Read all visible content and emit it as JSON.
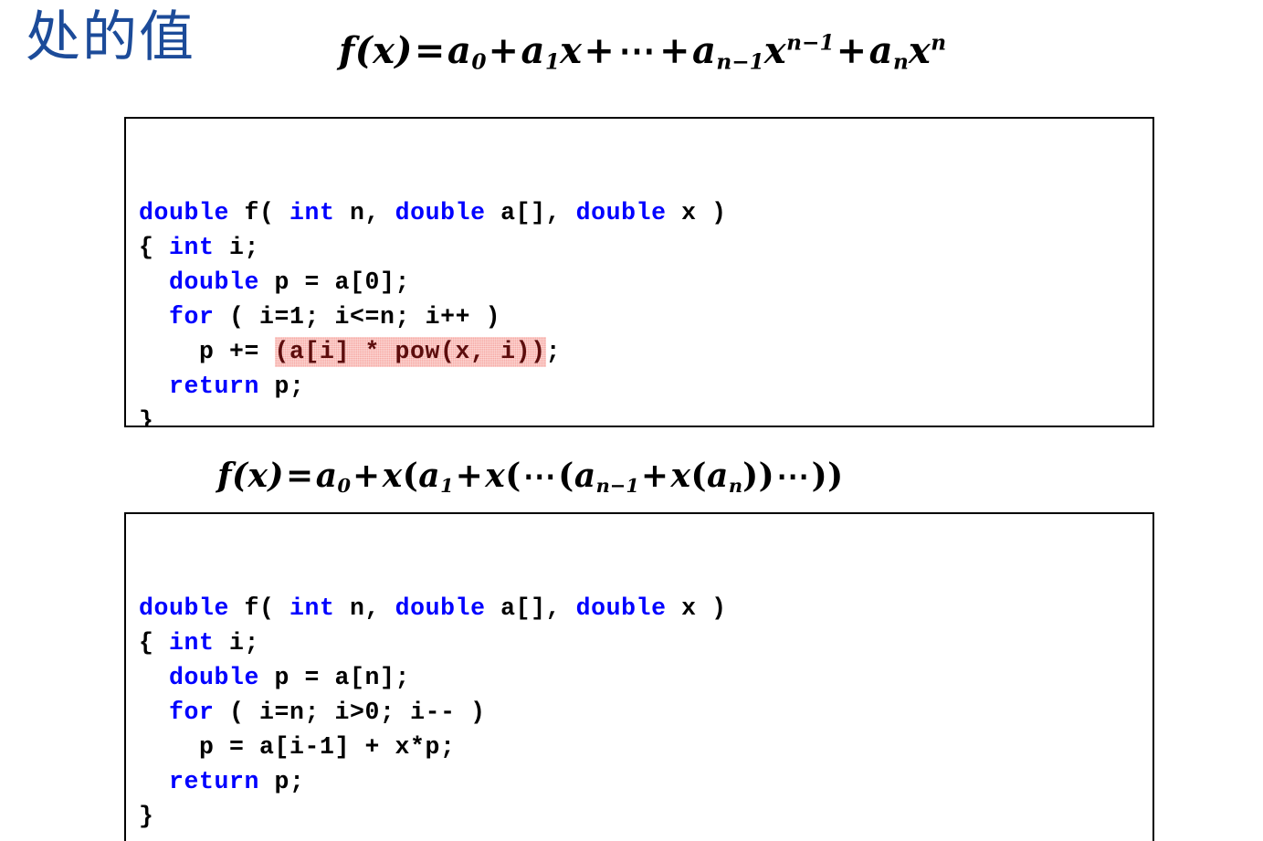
{
  "slide": {
    "title": "处的值",
    "accent_blue": "#1c4b99",
    "keyword_blue": "#0000ff",
    "highlight_bg": "#f7a9a4",
    "highlight_fg": "#5c0d0d",
    "text_black": "#000000",
    "background": "#ffffff"
  },
  "formulas": {
    "naive": {
      "lhs": "f(x)",
      "eq": "=",
      "t1": "a",
      "t1_sub": "0",
      "plus1": "+",
      "t2": "a",
      "t2_sub": "1",
      "t2_var": "x",
      "plus2": "+",
      "ellipsis": "⋯",
      "plus3": "+",
      "t3": "a",
      "t3_sub": "n−1",
      "t3_var": "x",
      "t3_sup": "n−1",
      "plus4": "+",
      "t4": "a",
      "t4_sub": "n",
      "t4_var": "x",
      "t4_sup": "n",
      "plain": "f(x) = a0 + a1x + ⋯ + a(n−1)x^(n−1) + a(n)x^n"
    },
    "horner": {
      "lhs": "f(x)",
      "eq": "=",
      "t1": "a",
      "t1_sub": "0",
      "plus1": "+",
      "x1": "x",
      "open1": "(",
      "t2": "a",
      "t2_sub": "1",
      "plus2": "+",
      "x2": "x",
      "open2": "(",
      "ellipsis1": "⋯",
      "open3": "(",
      "t3": "a",
      "t3_sub": "n−1",
      "plus3": "+",
      "x3": "x",
      "open4": "(",
      "t4": "a",
      "t4_sub": "n",
      "close1": "))",
      "ellipsis2": "⋯",
      "close2": "))",
      "plain": "f(x) = a0 + x(a1 + x(⋯(a(n−1) + x(a(n)))⋯))"
    }
  },
  "code_naive": {
    "lines": [
      [
        {
          "t": "double",
          "kw": true
        },
        {
          "t": " f( ",
          "kw": false
        },
        {
          "t": "int",
          "kw": true
        },
        {
          "t": " n, ",
          "kw": false
        },
        {
          "t": "double",
          "kw": true
        },
        {
          "t": " a[], ",
          "kw": false
        },
        {
          "t": "double",
          "kw": true
        },
        {
          "t": " x )",
          "kw": false
        }
      ],
      [
        {
          "t": "{ ",
          "kw": false
        },
        {
          "t": "int",
          "kw": true
        },
        {
          "t": " i;",
          "kw": false
        }
      ],
      [
        {
          "t": "  ",
          "kw": false
        },
        {
          "t": "double",
          "kw": true
        },
        {
          "t": " p = a[0];",
          "kw": false
        }
      ],
      [
        {
          "t": "  ",
          "kw": false
        },
        {
          "t": "for",
          "kw": true
        },
        {
          "t": " ( i=1; i<=n; i++ )",
          "kw": false
        }
      ],
      [
        {
          "t": "    p += ",
          "kw": false
        },
        {
          "t": "(a[i] * pow(x, i))",
          "kw": false,
          "hl": true
        },
        {
          "t": ";",
          "kw": false
        }
      ],
      [
        {
          "t": "  ",
          "kw": false
        },
        {
          "t": "return",
          "kw": true
        },
        {
          "t": " p;",
          "kw": false
        }
      ],
      [
        {
          "t": "}",
          "kw": false
        }
      ]
    ],
    "plain": "double f( int n, double a[], double x )\n{ int i;\n  double p = a[0];\n  for ( i=1; i<=n; i++ )\n    p += (a[i] * pow(x, i));\n  return p;\n}"
  },
  "code_horner": {
    "lines": [
      [
        {
          "t": "double",
          "kw": true
        },
        {
          "t": " f( ",
          "kw": false
        },
        {
          "t": "int",
          "kw": true
        },
        {
          "t": " n, ",
          "kw": false
        },
        {
          "t": "double",
          "kw": true
        },
        {
          "t": " a[], ",
          "kw": false
        },
        {
          "t": "double",
          "kw": true
        },
        {
          "t": " x )",
          "kw": false
        }
      ],
      [
        {
          "t": "{ ",
          "kw": false
        },
        {
          "t": "int",
          "kw": true
        },
        {
          "t": " i;",
          "kw": false
        }
      ],
      [
        {
          "t": "  ",
          "kw": false
        },
        {
          "t": "double",
          "kw": true
        },
        {
          "t": " p = a[n];",
          "kw": false
        }
      ],
      [
        {
          "t": "  ",
          "kw": false
        },
        {
          "t": "for",
          "kw": true
        },
        {
          "t": " ( i=n; i>0; i-- )",
          "kw": false
        }
      ],
      [
        {
          "t": "    p = a[i-1] + x*p;",
          "kw": false
        }
      ],
      [
        {
          "t": "  ",
          "kw": false
        },
        {
          "t": "return",
          "kw": true
        },
        {
          "t": " p;",
          "kw": false
        }
      ],
      [
        {
          "t": "}",
          "kw": false
        }
      ]
    ],
    "plain": "double f( int n, double a[], double x )\n{ int i;\n  double p = a[n];\n  for ( i=n; i>0; i-- )\n    p = a[i-1] + x*p;\n  return p;\n}"
  }
}
